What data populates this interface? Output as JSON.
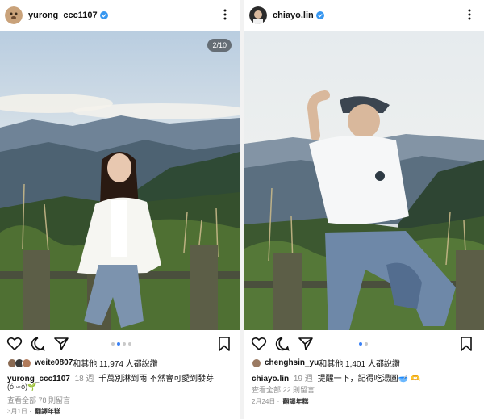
{
  "left_post": {
    "username": "yurong_ccc1107",
    "photo_counter": "2/10",
    "likes_user": "weite0807",
    "likes_text": "和其他 11,974 人都說讚",
    "caption_user": "yurong_ccc1107",
    "caption_ago": "18 週",
    "caption_text": "千萬別淋到雨 不然會可愛到發芽",
    "caption_emoji": "(ó‧ᵕ‧ò)🌱",
    "view_comments": "查看全部 78 則留言",
    "date": "3月1日",
    "translate": "翻譯年糕",
    "carousel_active_index": 1,
    "carousel_dots": 4
  },
  "right_post": {
    "username": "chiayo.lin",
    "likes_user": "chenghsin_yu",
    "likes_text": "和其他 1,401 人都說讚",
    "caption_user": "chiayo.lin",
    "caption_ago": "19 週",
    "caption_text": "提醒一下，記得吃湯圓🥣 🫶",
    "view_comments": "查看全部 22 則留言",
    "date": "2月24日",
    "translate": "翻譯年糕",
    "carousel_active_index": 0,
    "carousel_dots": 2
  },
  "icons": {
    "like": "heart-icon",
    "comment": "comment-icon",
    "share": "send-icon",
    "save": "bookmark-icon",
    "verified": "verified-badge-icon",
    "more": "more-options-icon"
  },
  "colors": {
    "verified": "#3897f0",
    "active_dot": "#3b82f6",
    "muted_text": "#8e8e8e"
  }
}
